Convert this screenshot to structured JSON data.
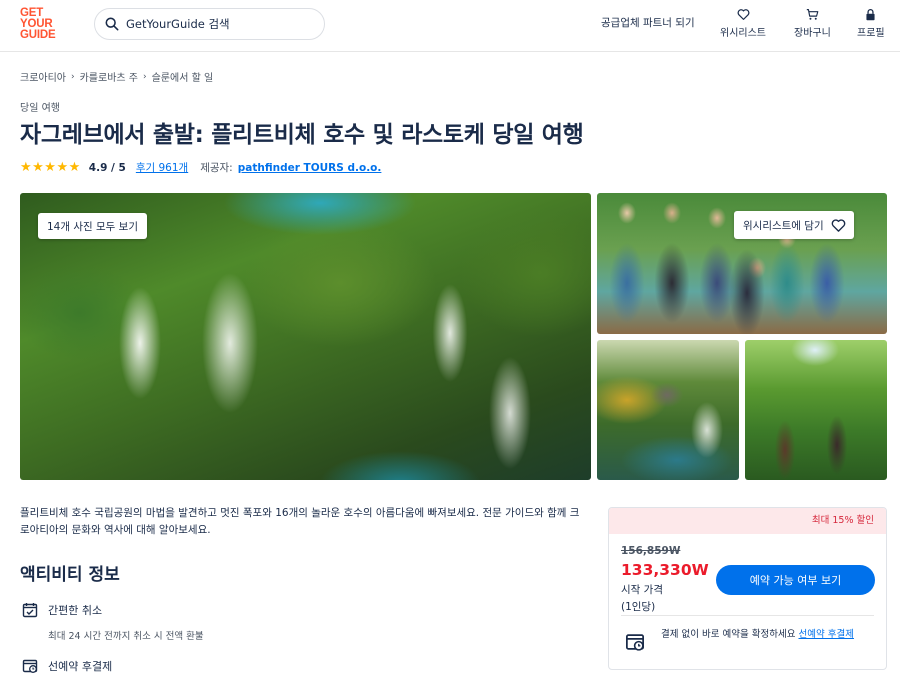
{
  "header": {
    "logo": [
      "GET",
      "YOUR",
      "GUIDE"
    ],
    "search_placeholder": "GetYourGuide 검색",
    "partner_link": "공급업체 파트너 되기",
    "wishlist": "위시리스트",
    "cart": "장바구니",
    "profile": "프로필"
  },
  "breadcrumb": [
    "크로아티아",
    "카를로바츠 주",
    "슬룬에서 할 일"
  ],
  "activity": {
    "category": "당일 여행",
    "title": "자그레브에서 출발: 플리트비체 호수 및 라스토케 당일 여행",
    "stars": "★★★★★",
    "rating": "4.9 / 5",
    "reviews": "후기 961개",
    "provider_label": "제공자:",
    "provider": "pathfinder TOURS d.o.o."
  },
  "gallery": {
    "all_photos": "14개 사진 모두 보기",
    "wishlist_add": "위시리스트에 담기"
  },
  "description": "플리트비체 호수 국립공원의 마법을 발견하고 멋진 폭포와 16개의 놀라운 호수의 아름다움에 빠져보세요. 전문 가이드와 함께 크로아티아의 문화와 역사에 대해 알아보세요.",
  "info": {
    "title": "액티비티 정보",
    "features": [
      {
        "title": "간편한 취소",
        "sub": "최대 24 시간 전까지 취소 시 전액 환불"
      },
      {
        "title": "선예약 후결제"
      }
    ]
  },
  "booking": {
    "discount": "최대 15% 할인",
    "old_price": "156,859W",
    "new_price": "133,330W",
    "price_label": "시작 가격",
    "price_unit": "(1인당)",
    "check_button": "예약 가능 여부 보기",
    "reserve_text": "결제 없이 바로 예약을 확정하세요",
    "reserve_link": "선예약 후결제"
  },
  "colors": {
    "brand": "#ff5533",
    "primary": "#0071eb",
    "price": "#eb1b2b",
    "stars": "#ffb800",
    "discount_bg": "#fde8ea"
  }
}
